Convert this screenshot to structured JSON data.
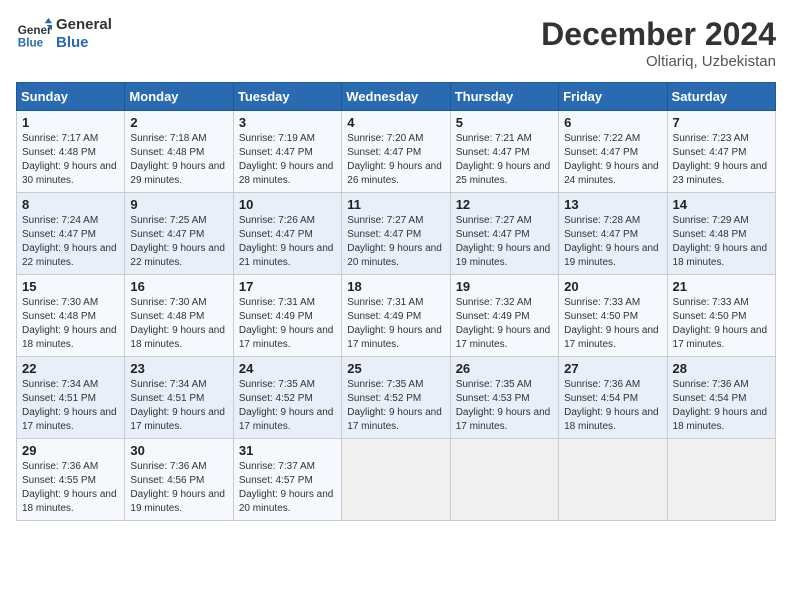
{
  "logo": {
    "line1": "General",
    "line2": "Blue"
  },
  "title": "December 2024",
  "location": "Oltiariq, Uzbekistan",
  "days_header": [
    "Sunday",
    "Monday",
    "Tuesday",
    "Wednesday",
    "Thursday",
    "Friday",
    "Saturday"
  ],
  "weeks": [
    [
      {
        "day": "1",
        "sunrise": "7:17 AM",
        "sunset": "4:48 PM",
        "daylight": "9 hours and 30 minutes."
      },
      {
        "day": "2",
        "sunrise": "7:18 AM",
        "sunset": "4:48 PM",
        "daylight": "9 hours and 29 minutes."
      },
      {
        "day": "3",
        "sunrise": "7:19 AM",
        "sunset": "4:47 PM",
        "daylight": "9 hours and 28 minutes."
      },
      {
        "day": "4",
        "sunrise": "7:20 AM",
        "sunset": "4:47 PM",
        "daylight": "9 hours and 26 minutes."
      },
      {
        "day": "5",
        "sunrise": "7:21 AM",
        "sunset": "4:47 PM",
        "daylight": "9 hours and 25 minutes."
      },
      {
        "day": "6",
        "sunrise": "7:22 AM",
        "sunset": "4:47 PM",
        "daylight": "9 hours and 24 minutes."
      },
      {
        "day": "7",
        "sunrise": "7:23 AM",
        "sunset": "4:47 PM",
        "daylight": "9 hours and 23 minutes."
      }
    ],
    [
      {
        "day": "8",
        "sunrise": "7:24 AM",
        "sunset": "4:47 PM",
        "daylight": "9 hours and 22 minutes."
      },
      {
        "day": "9",
        "sunrise": "7:25 AM",
        "sunset": "4:47 PM",
        "daylight": "9 hours and 22 minutes."
      },
      {
        "day": "10",
        "sunrise": "7:26 AM",
        "sunset": "4:47 PM",
        "daylight": "9 hours and 21 minutes."
      },
      {
        "day": "11",
        "sunrise": "7:27 AM",
        "sunset": "4:47 PM",
        "daylight": "9 hours and 20 minutes."
      },
      {
        "day": "12",
        "sunrise": "7:27 AM",
        "sunset": "4:47 PM",
        "daylight": "9 hours and 19 minutes."
      },
      {
        "day": "13",
        "sunrise": "7:28 AM",
        "sunset": "4:47 PM",
        "daylight": "9 hours and 19 minutes."
      },
      {
        "day": "14",
        "sunrise": "7:29 AM",
        "sunset": "4:48 PM",
        "daylight": "9 hours and 18 minutes."
      }
    ],
    [
      {
        "day": "15",
        "sunrise": "7:30 AM",
        "sunset": "4:48 PM",
        "daylight": "9 hours and 18 minutes."
      },
      {
        "day": "16",
        "sunrise": "7:30 AM",
        "sunset": "4:48 PM",
        "daylight": "9 hours and 18 minutes."
      },
      {
        "day": "17",
        "sunrise": "7:31 AM",
        "sunset": "4:49 PM",
        "daylight": "9 hours and 17 minutes."
      },
      {
        "day": "18",
        "sunrise": "7:31 AM",
        "sunset": "4:49 PM",
        "daylight": "9 hours and 17 minutes."
      },
      {
        "day": "19",
        "sunrise": "7:32 AM",
        "sunset": "4:49 PM",
        "daylight": "9 hours and 17 minutes."
      },
      {
        "day": "20",
        "sunrise": "7:33 AM",
        "sunset": "4:50 PM",
        "daylight": "9 hours and 17 minutes."
      },
      {
        "day": "21",
        "sunrise": "7:33 AM",
        "sunset": "4:50 PM",
        "daylight": "9 hours and 17 minutes."
      }
    ],
    [
      {
        "day": "22",
        "sunrise": "7:34 AM",
        "sunset": "4:51 PM",
        "daylight": "9 hours and 17 minutes."
      },
      {
        "day": "23",
        "sunrise": "7:34 AM",
        "sunset": "4:51 PM",
        "daylight": "9 hours and 17 minutes."
      },
      {
        "day": "24",
        "sunrise": "7:35 AM",
        "sunset": "4:52 PM",
        "daylight": "9 hours and 17 minutes."
      },
      {
        "day": "25",
        "sunrise": "7:35 AM",
        "sunset": "4:52 PM",
        "daylight": "9 hours and 17 minutes."
      },
      {
        "day": "26",
        "sunrise": "7:35 AM",
        "sunset": "4:53 PM",
        "daylight": "9 hours and 17 minutes."
      },
      {
        "day": "27",
        "sunrise": "7:36 AM",
        "sunset": "4:54 PM",
        "daylight": "9 hours and 18 minutes."
      },
      {
        "day": "28",
        "sunrise": "7:36 AM",
        "sunset": "4:54 PM",
        "daylight": "9 hours and 18 minutes."
      }
    ],
    [
      {
        "day": "29",
        "sunrise": "7:36 AM",
        "sunset": "4:55 PM",
        "daylight": "9 hours and 18 minutes."
      },
      {
        "day": "30",
        "sunrise": "7:36 AM",
        "sunset": "4:56 PM",
        "daylight": "9 hours and 19 minutes."
      },
      {
        "day": "31",
        "sunrise": "7:37 AM",
        "sunset": "4:57 PM",
        "daylight": "9 hours and 20 minutes."
      },
      null,
      null,
      null,
      null
    ]
  ]
}
